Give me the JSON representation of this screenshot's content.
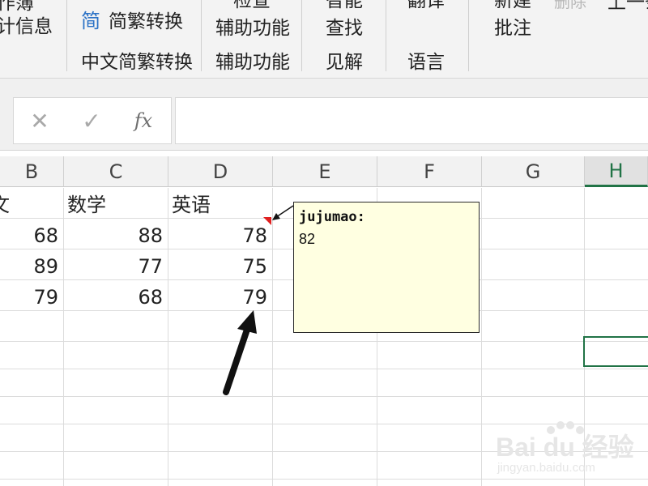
{
  "ribbon": {
    "workbook_stats_partial": "作簿",
    "workbook_stats_line2": "计信息",
    "chinese_convert_icon": "简",
    "chinese_convert_button": "简繁转换",
    "chinese_convert_group": "中文简繁转换",
    "accessibility_check_line1": "检查",
    "accessibility_check_line2": "辅助功能",
    "accessibility_group": "辅助功能",
    "smart_lookup_line1": "智能",
    "smart_lookup_line2": "查找",
    "insights_group": "见解",
    "translate_button": "翻译",
    "language_group": "语言",
    "new_comment_line1": "新建",
    "new_comment_line2": "批注",
    "delete_button": "删除",
    "previous_button": "上一条"
  },
  "formula_bar": {
    "cancel_icon": "✕",
    "enter_icon": "✓",
    "insert_function": "fx",
    "content": ""
  },
  "columns": [
    "B",
    "C",
    "D",
    "E",
    "F",
    "G",
    "H"
  ],
  "sheet": {
    "header_row": [
      "文",
      "数学",
      "英语"
    ],
    "rows": [
      [
        "68",
        "88",
        "78"
      ],
      [
        "89",
        "77",
        "75"
      ],
      [
        "79",
        "68",
        "79"
      ]
    ]
  },
  "comment": {
    "author": "jujumao:",
    "text": "82"
  },
  "watermark": {
    "brand": "Bai du 经验",
    "url": "jingyan.baidu.com"
  },
  "colors": {
    "selection": "#217346",
    "comment_bg": "#ffffe1",
    "comment_indicator": "#e02020"
  }
}
